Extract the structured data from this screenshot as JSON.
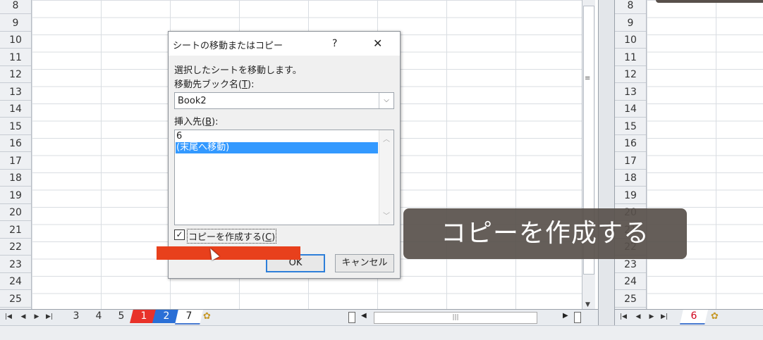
{
  "left_pane": {
    "row_numbers": [
      "8",
      "9",
      "10",
      "11",
      "12",
      "13",
      "14",
      "15",
      "16",
      "17",
      "18",
      "19",
      "20",
      "21",
      "22",
      "23",
      "24",
      "25"
    ],
    "sheet_tabs": [
      {
        "label": "3",
        "color": "#e9ecf0",
        "text_color": "#333333"
      },
      {
        "label": "4",
        "color": "#e9ecf0",
        "text_color": "#333333"
      },
      {
        "label": "5",
        "color": "#e9ecf0",
        "text_color": "#333333"
      },
      {
        "label": "1",
        "color": "#e8322a",
        "text_color": "#ffffff"
      },
      {
        "label": "2",
        "color": "#2a6fd6",
        "text_color": "#ffffff"
      },
      {
        "label": "7",
        "color": "#ffffff",
        "text_color": "#222222",
        "active": true
      }
    ]
  },
  "right_pane": {
    "row_numbers": [
      "8",
      "9",
      "10",
      "11",
      "12",
      "13",
      "14",
      "15",
      "16",
      "17",
      "18",
      "19",
      "20",
      "21",
      "22",
      "23",
      "24",
      "25"
    ],
    "sheet_tabs": [
      {
        "label": "6",
        "color": "#ffffff",
        "text_color": "#d0021b",
        "active": true
      }
    ]
  },
  "dialog": {
    "title": "シートの移動またはコピー",
    "help": "?",
    "close": "✕",
    "instruction": "選択したシートを移動します。",
    "book_label": "移動先ブック名(",
    "book_key": "T",
    "book_label_end": "):",
    "book_value": "Book2",
    "insert_label": "挿入先(",
    "insert_key": "B",
    "insert_label_end": "):",
    "insert_items": [
      "6",
      "(末尾へ移動)"
    ],
    "selected_index": 1,
    "copy_label": "コピーを作成する(",
    "copy_key": "C",
    "copy_label_end": ")",
    "copy_checked": true,
    "ok_label": "OK",
    "cancel_label": "キャンセル"
  },
  "caption": "コピーを作成する",
  "colors": {
    "accent_red": "#e8401c",
    "selection_blue": "#3399ff",
    "caption_bg": "#58504b"
  }
}
